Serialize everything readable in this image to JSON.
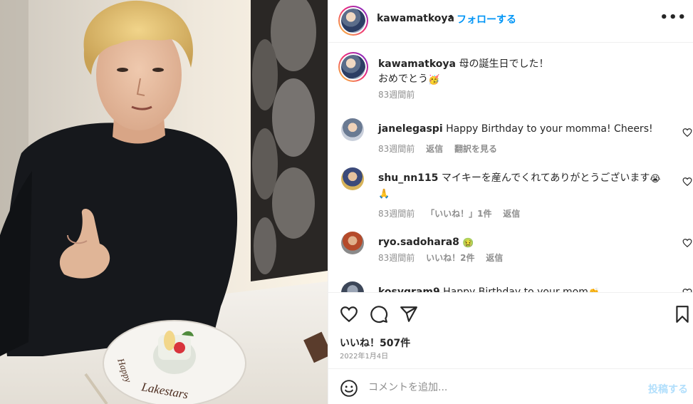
{
  "post": {
    "username": "kawamatkoya",
    "separator": "•",
    "follow_label": "フォローする",
    "more_label": "•••"
  },
  "caption": {
    "username": "kawamatkoya",
    "text_line1": "母の誕生日でした！",
    "text_line2": "おめでとう",
    "emoji": "🥳",
    "time_ago": "83週間前"
  },
  "comments": [
    {
      "username": "janelegaspi",
      "text": "Happy Birthday to your momma! Cheers!",
      "time_ago": "83週間前",
      "reply_label": "返信",
      "translate_label": "翻訳を見る"
    },
    {
      "username": "shu_nn115",
      "text": "マイキーを産んでくれてありがとうございます",
      "emoji_a": "😭",
      "emoji_b": "🙏",
      "time_ago": "83週間前",
      "likes_label": "「いいね！」1件",
      "reply_label": "返信"
    },
    {
      "username": "ryo.sadohara8",
      "text": "",
      "emoji_a": "🤢",
      "time_ago": "83週間前",
      "likes_label": "いいね！2件",
      "reply_label": "返信"
    },
    {
      "username": "kosygram9",
      "text": "Happy Birthday to your mom",
      "emoji_a": "👏"
    }
  ],
  "likes": {
    "label": "いいね！507件",
    "date": "2022年1月4日"
  },
  "add_comment": {
    "placeholder": "コメントを追加...",
    "post_label": "投稿する"
  },
  "photo": {
    "plate_text_1": "Happy",
    "plate_text_2": "Lakestars"
  },
  "colors": {
    "link_blue": "#0095f6",
    "post_disabled": "#b2dffc",
    "muted": "#8e8e8e"
  }
}
